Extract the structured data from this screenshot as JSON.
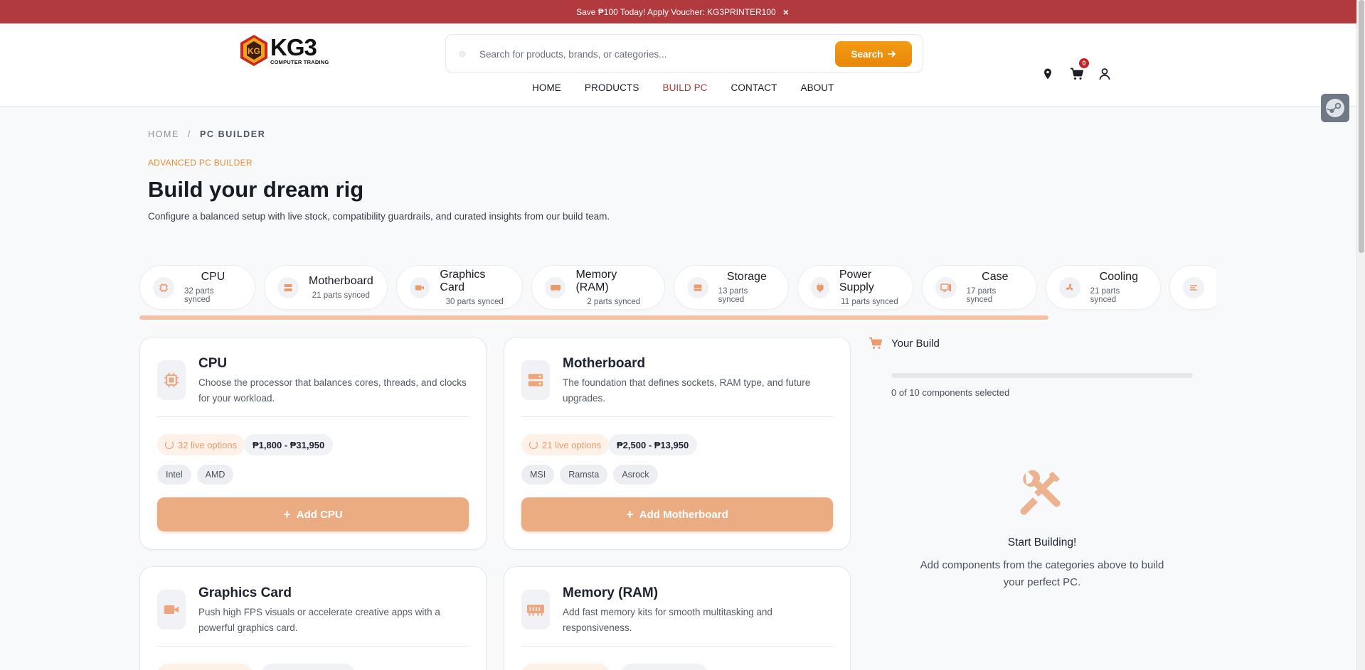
{
  "promo": {
    "text": "Save ₱100 Today! Apply Voucher: KG3PRINTER100",
    "close": "×"
  },
  "brand": {
    "name": "KG3",
    "tagline": "COMPUTER TRADING"
  },
  "search": {
    "placeholder": "Search for products, brands, or categories...",
    "button": "Search"
  },
  "nav": [
    "HOME",
    "PRODUCTS",
    "BUILD PC",
    "CONTACT",
    "ABOUT"
  ],
  "nav_active": "BUILD PC",
  "cart_count": "0",
  "breadcrumb": {
    "home": "HOME",
    "sep": "/",
    "current": "PC BUILDER"
  },
  "hero": {
    "eyebrow": "ADVANCED PC BUILDER",
    "title": "Build your dream rig",
    "subtitle": "Configure a balanced setup with live stock, compatibility guardrails, and curated insights from our build team."
  },
  "categories": [
    {
      "name": "CPU",
      "count": "32 parts synced",
      "icon": "cpu-icon"
    },
    {
      "name": "Motherboard",
      "count": "21 parts synced",
      "icon": "motherboard-icon"
    },
    {
      "name": "Graphics Card",
      "count": "30 parts synced",
      "icon": "video-icon"
    },
    {
      "name": "Memory (RAM)",
      "count": "2 parts synced",
      "icon": "memory-icon"
    },
    {
      "name": "Storage",
      "count": "13 parts synced",
      "icon": "storage-icon"
    },
    {
      "name": "Power Supply",
      "count": "11 parts synced",
      "icon": "plug-icon"
    },
    {
      "name": "Case",
      "count": "17 parts synced",
      "icon": "case-icon"
    },
    {
      "name": "Cooling",
      "count": "21 parts synced",
      "icon": "fan-icon"
    }
  ],
  "cards": [
    {
      "name": "CPU",
      "desc": "Choose the processor that balances cores, threads, and clocks for your workload.",
      "live": "32 live options",
      "price": "₱1,800 - ₱31,950",
      "brands": [
        "Intel",
        "AMD"
      ],
      "add": "Add CPU",
      "icon": "cpu-icon"
    },
    {
      "name": "Motherboard",
      "desc": "The foundation that defines sockets, RAM type, and future upgrades.",
      "live": "21 live options",
      "price": "₱2,500 - ₱13,950",
      "brands": [
        "MSI",
        "Ramsta",
        "Asrock"
      ],
      "add": "Add Motherboard",
      "icon": "motherboard-icon"
    },
    {
      "name": "Graphics Card",
      "desc": "Push high FPS visuals or accelerate creative apps with a powerful graphics card.",
      "icon": "video-icon"
    },
    {
      "name": "Memory (RAM)",
      "desc": "Add fast memory kits for smooth multitasking and responsiveness.",
      "icon": "memory-icon"
    }
  ],
  "build": {
    "title": "Your Build",
    "count": "0 of 10 components selected",
    "progress": 0,
    "empty_title": "Start Building!",
    "empty_text": "Add components from the categories above to build your perfect PC."
  },
  "colors": {
    "promo": "#b03a3e",
    "accent": "#e8860a",
    "soft_accent": "#ecac82",
    "active_nav": "#b03a3e"
  }
}
